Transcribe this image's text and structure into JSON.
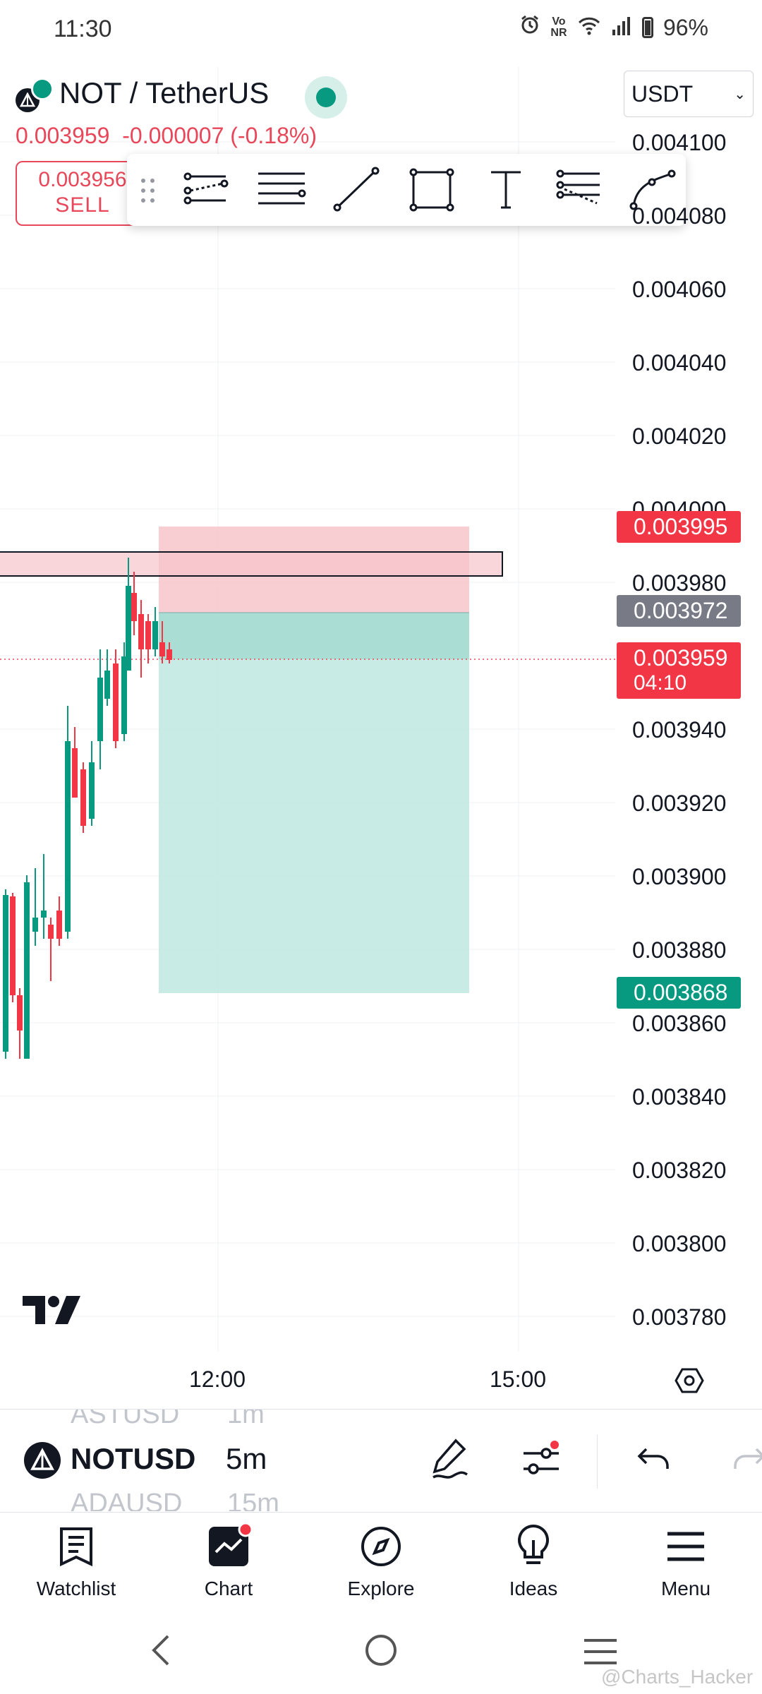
{
  "status_bar": {
    "time": "11:30",
    "network_label": "Vo NR",
    "battery": "96%",
    "icons": [
      "alarm-icon",
      "volte-icon",
      "wifi-icon",
      "signal-icon",
      "battery-icon"
    ]
  },
  "header": {
    "symbol": "NOT / TetherUS",
    "last_price": "0.003959",
    "change": "-0.000007 (-0.18%)",
    "currency": "USDT",
    "sell_price": "0.003956",
    "sell_label": "SELL",
    "market_status_color": "#089981"
  },
  "drawing_toolbar": {
    "tools": [
      "trend-angle-icon",
      "horizontal-lines-icon",
      "trend-line-icon",
      "rectangle-icon",
      "text-icon",
      "pitchfork-icon",
      "curve-icon"
    ]
  },
  "chart": {
    "price_axis": [
      "0.004100",
      "0.004080",
      "0.004060",
      "0.004040",
      "0.004020",
      "0.004000",
      "0.003980",
      "0.003940",
      "0.003920",
      "0.003900",
      "0.003880",
      "0.003860",
      "0.003840",
      "0.003820",
      "0.003800",
      "0.003780"
    ],
    "time_axis": [
      "12:00",
      "15:00"
    ],
    "badges": {
      "stop_price": "0.003995",
      "entry_price": "0.003972",
      "current_price": "0.003959",
      "countdown": "04:10",
      "target_price": "0.003868"
    },
    "colors": {
      "up": "#089981",
      "down": "#f23645",
      "stop_zone": "#f7c5cb",
      "target_zone": "#c3e9e2"
    }
  },
  "symbol_bar": {
    "prev_symbol": "ASTUSD",
    "prev_interval": "1m",
    "symbol": "NOTUSD",
    "interval": "5m",
    "next_symbol": "ADAUSD",
    "next_interval": "15m"
  },
  "bottom_nav": {
    "items": [
      "Watchlist",
      "Chart",
      "Explore",
      "Ideas",
      "Menu"
    ]
  },
  "watermark": "@Charts_Hacker"
}
